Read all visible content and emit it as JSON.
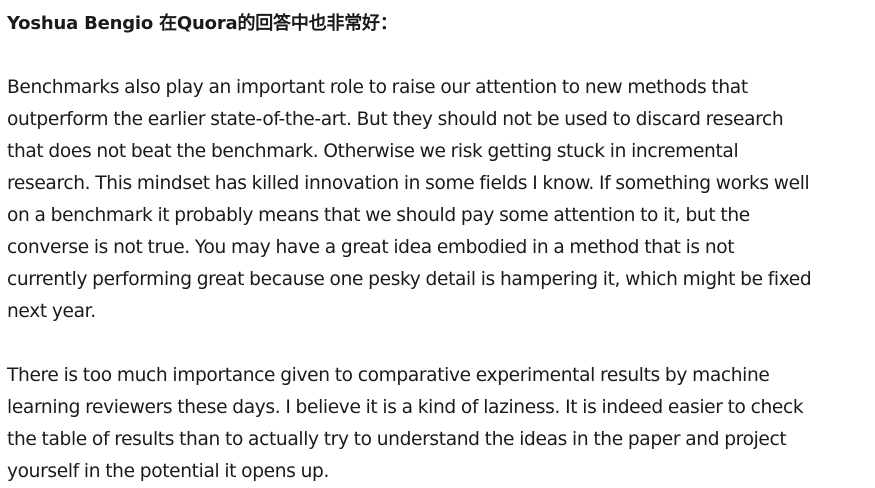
{
  "heading": "Yoshua Bengio 在Quora的回答中也非常好：",
  "paragraphs": [
    {
      "lines": [
        "Benchmarks also play an important role to raise our attention to new methods that",
        "outperform the earlier state-of-the-art. But they should not be used to discard research",
        "that does not beat the benchmark. Otherwise we risk getting stuck in incremental",
        "research. This mindset has killed innovation in some fields I know. If something works well",
        "on a benchmark it probably means that we should pay some attention to it, but the",
        "converse is not true. You may have a great idea embodied in a method that is not",
        "currently performing great because one pesky detail is hampering it, which might be fixed",
        "next year."
      ]
    },
    {
      "lines": [
        "There is too much importance given to comparative experimental results by machine",
        "learning reviewers these days. I believe it is a kind of laziness. It is indeed easier to check",
        "the table of results than to actually try to understand the ideas in the paper and project",
        "yourself in the potential it opens up."
      ]
    }
  ]
}
